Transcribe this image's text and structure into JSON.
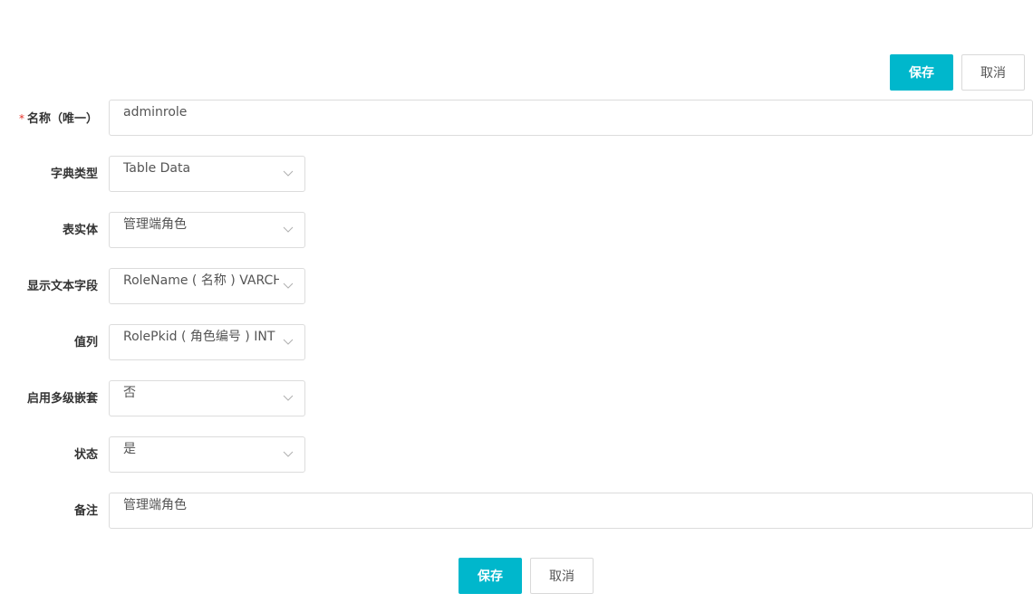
{
  "toolbar": {
    "save_label": "保存",
    "cancel_label": "取消"
  },
  "form": {
    "name": {
      "required_mark": "*",
      "label": "名称（唯一）",
      "value": "adminrole"
    },
    "dict_type": {
      "label": "字典类型",
      "value": "Table Data"
    },
    "table_entity": {
      "label": "表实体",
      "value": "管理端角色"
    },
    "display_field": {
      "label": "显示文本字段",
      "value": "RoleName ( 名称 ) VARCHAR"
    },
    "value_column": {
      "label": "值列",
      "value": "RolePkid ( 角色编号 ) INT"
    },
    "multi_level": {
      "label": "启用多级嵌套",
      "value": "否"
    },
    "status": {
      "label": "状态",
      "value": "是"
    },
    "remark": {
      "label": "备注",
      "value": "管理端角色"
    }
  },
  "footer": {
    "save_label": "保存",
    "cancel_label": "取消"
  },
  "colors": {
    "primary": "#00b7cc",
    "required": "#e5332a",
    "border": "#dcdcdc"
  },
  "icons": {
    "select_arrow": "chevron-down-icon"
  }
}
